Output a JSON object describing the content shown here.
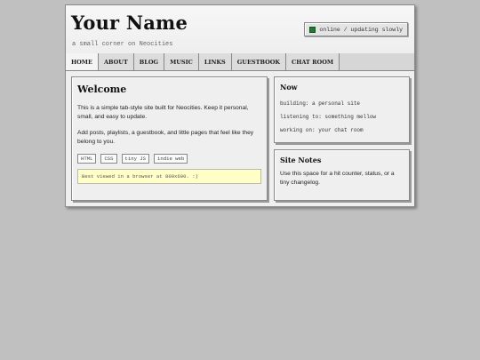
{
  "header": {
    "title": "Your Name",
    "tagline": "a small corner on Neocities",
    "status": "online / updating slowly"
  },
  "colors": {
    "page_bg": "#c0c0c0",
    "status_dot": "#1f7a36",
    "notice_bg": "#ffffc8"
  },
  "tabs": [
    {
      "label": "HOME",
      "active": true
    },
    {
      "label": "ABOUT",
      "active": false
    },
    {
      "label": "BLOG",
      "active": false
    },
    {
      "label": "MUSIC",
      "active": false
    },
    {
      "label": "LINKS",
      "active": false
    },
    {
      "label": "GUESTBOOK",
      "active": false
    },
    {
      "label": "CHAT ROOM",
      "active": false
    }
  ],
  "welcome": {
    "heading": "Welcome",
    "para1": "This is a simple tab-style site built for Neocities. Keep it personal, small, and easy to update.",
    "para2": "Add posts, playlists, a guestbook, and little pages that feel like they belong to you.",
    "tags": [
      "HTML",
      "CSS",
      "tiny JS",
      "indie web"
    ],
    "notice": "Best viewed in a browser at 800x600. :)"
  },
  "now": {
    "heading": "Now",
    "lines": [
      "building: a personal site",
      "listening to: something mellow",
      "working on: your chat room"
    ]
  },
  "notes": {
    "heading": "Site Notes",
    "text": "Use this space for a hit counter, status, or a tiny changelog."
  }
}
